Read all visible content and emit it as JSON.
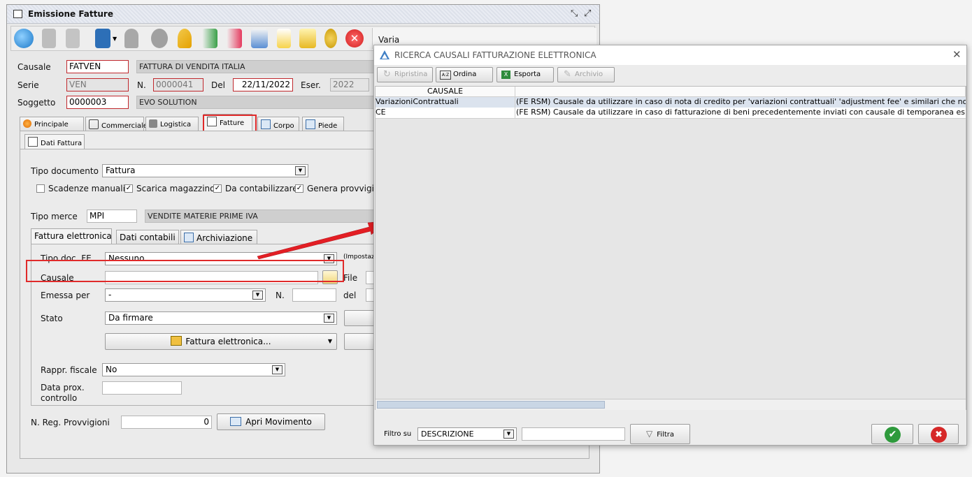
{
  "window": {
    "title": "Emissione Fatture",
    "toolbar_extra": "Varia"
  },
  "header": {
    "causale_label": "Causale",
    "causale_code": "FATVEN",
    "causale_desc": "FATTURA DI VENDITA ITALIA",
    "serie_label": "Serie",
    "serie_value": "VEN",
    "n_label": "N.",
    "n_value": "0000041",
    "del_label": "Del",
    "del_value": "22/11/2022",
    "eser_label": "Eser.",
    "eser_value": "2022",
    "soggetto_label": "Soggetto",
    "soggetto_code": "0000003",
    "soggetto_desc": "EVO SOLUTION"
  },
  "tabs": [
    "Principale",
    "Commerciale",
    "Logistica",
    "Fatture",
    "Corpo",
    "Piede"
  ],
  "subtab": "Dati Fattura",
  "dati": {
    "tipo_documento_label": "Tipo documento",
    "tipo_documento_value": "Fattura",
    "checks": [
      {
        "label": "Scadenze manuali",
        "checked": false
      },
      {
        "label": "Scarica magazzino",
        "checked": true
      },
      {
        "label": "Da contabilizzare",
        "checked": true
      },
      {
        "label": "Genera provvigioni",
        "checked": true
      }
    ],
    "check_mark": "✓",
    "tipo_merce_label": "Tipo merce",
    "tipo_merce_code": "MPI",
    "tipo_merce_desc": "VENDITE MATERIE PRIME IVA"
  },
  "inner_tabs": [
    "Fattura elettronica",
    "Dati contabili",
    "Archiviazione"
  ],
  "fe": {
    "tipo_doc_label": "Tipo doc. FE",
    "tipo_doc_value": "Nessuno",
    "impostaz": "(Impostaz",
    "causale_label": "Causale",
    "causale_value": "",
    "file_label": "File",
    "emessa_label": "Emessa per",
    "emessa_value": "-",
    "n_label": "N.",
    "del_label": "del",
    "stato_label": "Stato",
    "stato_value": "Da firmare",
    "fattura_btn": "Fattura elettronica...",
    "rappr_label": "Rappr. fiscale",
    "rappr_value": "No",
    "data_prox_label_1": "Data prox.",
    "data_prox_label_2": "controllo"
  },
  "footer": {
    "nreg_label": "N. Reg. Provvigioni",
    "nreg_value": "0",
    "apri_btn": "Apri Movimento"
  },
  "dialog": {
    "title": "RICERCA CAUSALI FATTURAZIONE ELETTRONICA",
    "buttons": {
      "ripristina": "Ripristina",
      "ordina": "Ordina",
      "esporta": "Esporta",
      "archivio": "Archivio"
    },
    "column_header": "CAUSALE",
    "rows": [
      {
        "code": "VariazioniContrattuali",
        "desc": "(FE RSM) Causale da utilizzare in caso di nota di credito per 'variazioni contrattuali' 'adjustment fee' e similari che non s"
      },
      {
        "code": "CE",
        "desc": "(FE RSM) Causale da utilizzare in caso di fatturazione di beni precedentemente inviati con causale di temporanea espo"
      }
    ],
    "filter_label": "Filtro su",
    "filter_field": "DESCRIZIONE",
    "filter_value": "",
    "filtra_btn": "Filtra"
  },
  "colors": {
    "highlight": "#e02a2a",
    "selected_row": "#dbe3ee",
    "ok_green": "#2e9a3c",
    "cancel_red": "#d62828"
  }
}
